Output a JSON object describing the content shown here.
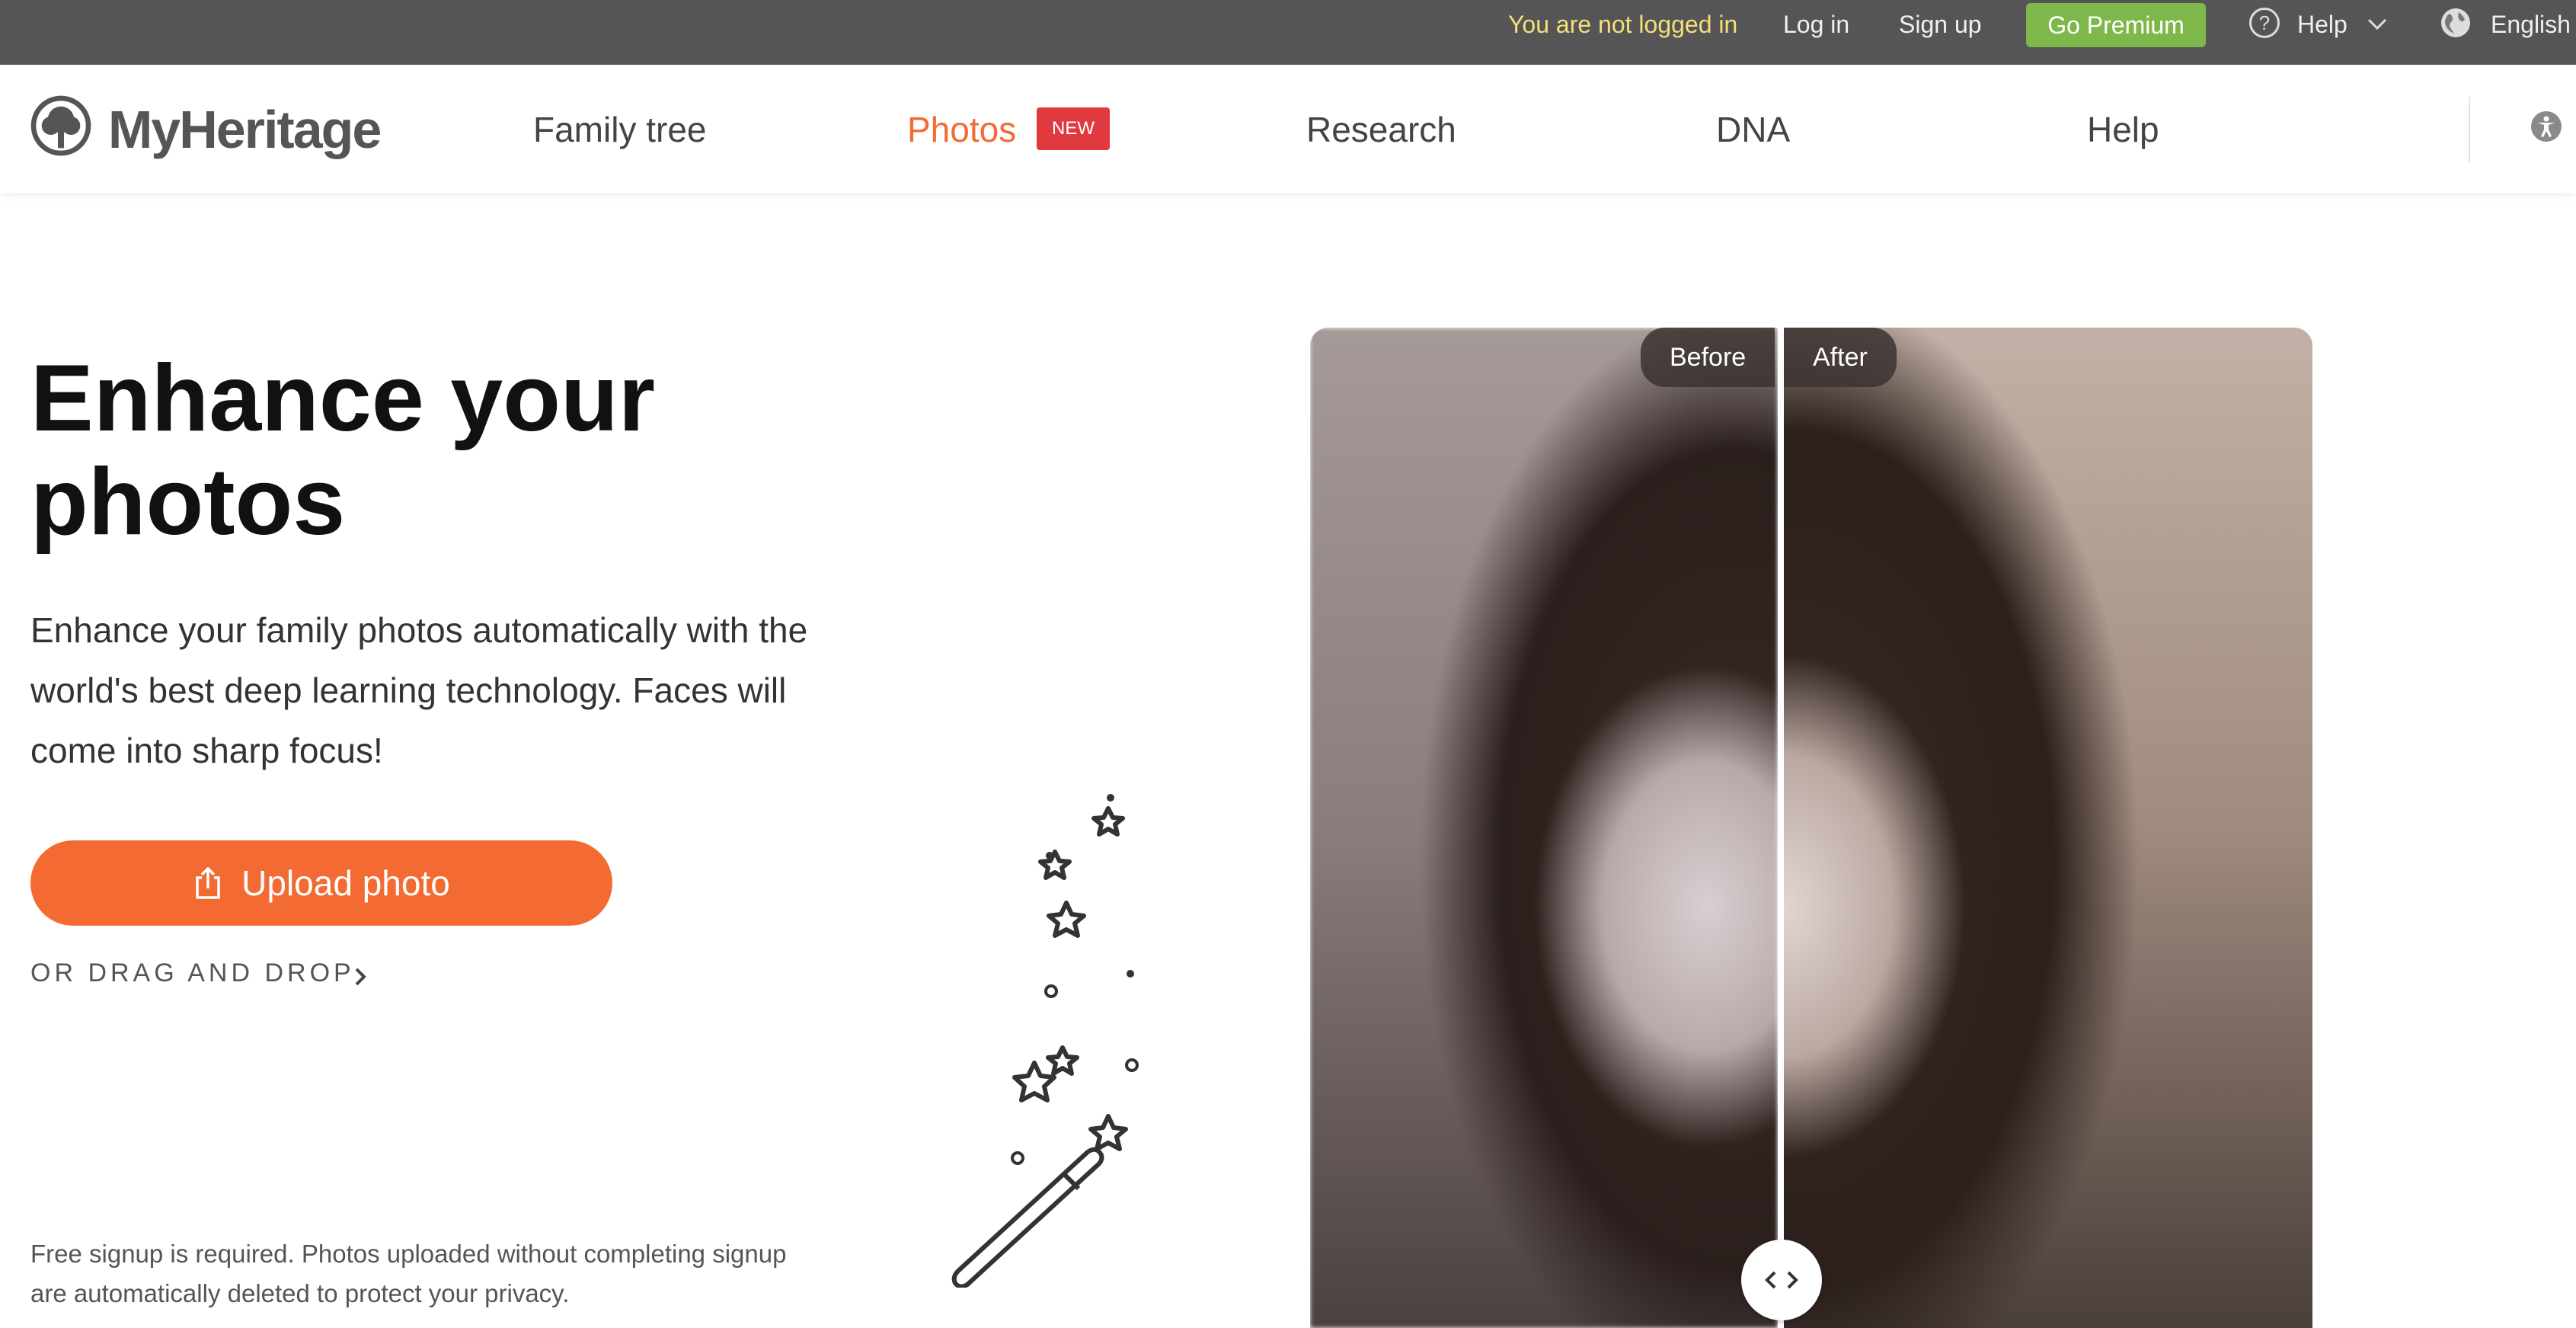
{
  "topbar": {
    "not_logged_in": "You are not logged in",
    "login": "Log in",
    "signup": "Sign up",
    "premium": "Go Premium",
    "help": "Help",
    "language": "English"
  },
  "nav": {
    "brand": "MyHeritage",
    "items": [
      {
        "label": "Family tree"
      },
      {
        "label": "Photos",
        "badge": "NEW"
      },
      {
        "label": "Research"
      },
      {
        "label": "DNA"
      },
      {
        "label": "Help"
      }
    ]
  },
  "hero": {
    "title": "Enhance your photos",
    "subtitle": "Enhance your family photos automatically with the world's best deep learning technology. Faces will come into sharp focus!",
    "upload_label": "Upload photo",
    "drag_label": "OR DRAG AND DROP",
    "disclaimer": "Free signup is required. Photos uploaded without completing signup are automatically deleted to protect your privacy."
  },
  "comparison": {
    "before_label": "Before",
    "after_label": "After"
  },
  "colors": {
    "accent": "#f36b32",
    "premium": "#7fb84a",
    "badge": "#e0393e",
    "topbar": "#555555"
  },
  "icons": [
    "help-icon",
    "chevron-down-icon",
    "globe-icon",
    "accessibility-icon",
    "upload-icon",
    "chevron-right-icon",
    "magic-wand-icon",
    "compare-arrows-icon"
  ]
}
